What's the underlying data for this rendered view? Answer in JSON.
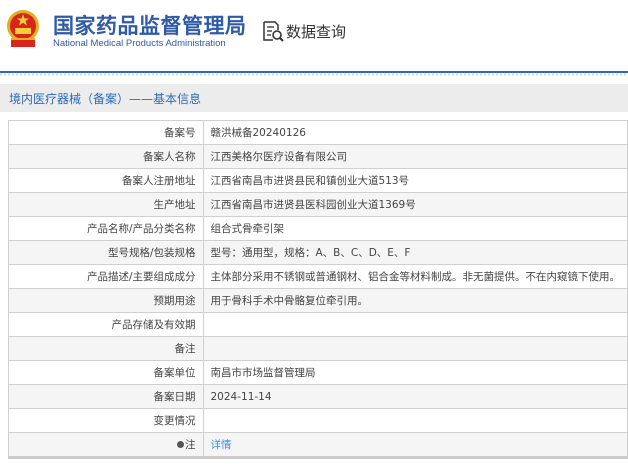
{
  "header": {
    "site_name_cn": "国家药品监督管理局",
    "site_name_en": "National Medical Products Administration",
    "query_label": "数据查询",
    "query_icon": "document-search-icon"
  },
  "section_title": "境内医疗器械（备案）——基本信息",
  "colors": {
    "brand_blue": "#2f5aa8",
    "link_blue": "#3a8ee6",
    "rule_blue": "#2b6cb0"
  },
  "rows": [
    {
      "label": "备案号",
      "value": "赣洪械备20240126"
    },
    {
      "label": "备案人名称",
      "value": "江西美格尔医疗设备有限公司"
    },
    {
      "label": "备案人注册地址",
      "value": "江西省南昌市进贤县民和镇创业大道513号"
    },
    {
      "label": "生产地址",
      "value": "江西省南昌市进贤县医科园创业大道1369号"
    },
    {
      "label": "产品名称/产品分类名称",
      "value": "组合式骨牵引架"
    },
    {
      "label": "型号规格/包装规格",
      "value": "型号：通用型，规格：A、B、C、D、E、F"
    },
    {
      "label": "产品描述/主要组成成分",
      "value": "主体部分采用不锈钢或普通钢材、铝合金等材料制成。非无菌提供。不在内窥镜下使用。"
    },
    {
      "label": "预期用途",
      "value": "用于骨科手术中骨骼复位牵引用。"
    },
    {
      "label": "产品存储及有效期",
      "value": ""
    },
    {
      "label": "备注",
      "value": ""
    },
    {
      "label": "备案单位",
      "value": "南昌市市场监督管理局"
    },
    {
      "label": "备案日期",
      "value": "2024-11-14"
    },
    {
      "label": "变更情况",
      "value": ""
    },
    {
      "label": "注",
      "value": "详情"
    }
  ]
}
